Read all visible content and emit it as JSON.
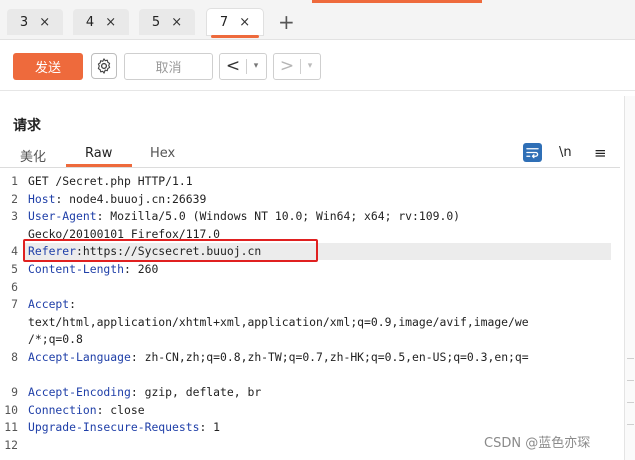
{
  "tabs": [
    {
      "label": "3",
      "close": "×",
      "active": false
    },
    {
      "label": "4",
      "close": "×",
      "active": false
    },
    {
      "label": "5",
      "close": "×",
      "active": false
    },
    {
      "label": "7",
      "close": "×",
      "active": true
    }
  ],
  "new_tab": "+",
  "toolbar": {
    "send_label": "发送",
    "cancel_label": "取消",
    "back_arrow": "<",
    "forward_arrow": ">",
    "dropdown": "▾"
  },
  "request": {
    "title": "请求",
    "subtabs": [
      "美化",
      "Raw",
      "Hex"
    ],
    "active_subtab": "Raw",
    "newline_toggle": "\\n",
    "menu_glyph": "≡"
  },
  "editor": {
    "lines": [
      {
        "num": "1",
        "key": "",
        "value": "GET /Secret.php HTTP/1.1"
      },
      {
        "num": "2",
        "key": "Host",
        "value": ": node4.buuoj.cn:26639"
      },
      {
        "num": "3",
        "key": "User-Agent",
        "value": ": Mozilla/5.0 (Windows NT 10.0; Win64; x64; rv:109.0)"
      },
      {
        "num": "",
        "key": "",
        "value": "Gecko/20100101 Firefox/117.0"
      },
      {
        "num": "4",
        "key": "Referer",
        "value": ":https://Sycsecret.buuoj.cn"
      },
      {
        "num": "5",
        "key": "Content-Length",
        "value": ": 260"
      },
      {
        "num": "6",
        "key": "",
        "value": ""
      },
      {
        "num": "7",
        "key": "Accept",
        "value": ":"
      },
      {
        "num": "",
        "key": "",
        "value": "text/html,application/xhtml+xml,application/xml;q=0.9,image/avif,image/we"
      },
      {
        "num": "",
        "key": "",
        "value": "/*;q=0.8"
      },
      {
        "num": "8",
        "key": "Accept-Language",
        "value": ": zh-CN,zh;q=0.8,zh-TW;q=0.7,zh-HK;q=0.5,en-US;q=0.3,en;q="
      },
      {
        "num": "",
        "key": "",
        "value": ""
      },
      {
        "num": "9",
        "key": "Accept-Encoding",
        "value": ": gzip, deflate, br"
      },
      {
        "num": "10",
        "key": "Connection",
        "value": ": close"
      },
      {
        "num": "11",
        "key": "Upgrade-Insecure-Requests",
        "value": ": 1"
      },
      {
        "num": "12",
        "key": "",
        "value": ""
      }
    ],
    "highlighted_line": "4"
  },
  "watermark": "CSDN @蓝色亦琛",
  "colors": {
    "accent": "#ee6a3c",
    "header_key": "#1f3fa8",
    "annotation_box": "#e02020",
    "icon_blue": "#2f6fb6"
  }
}
